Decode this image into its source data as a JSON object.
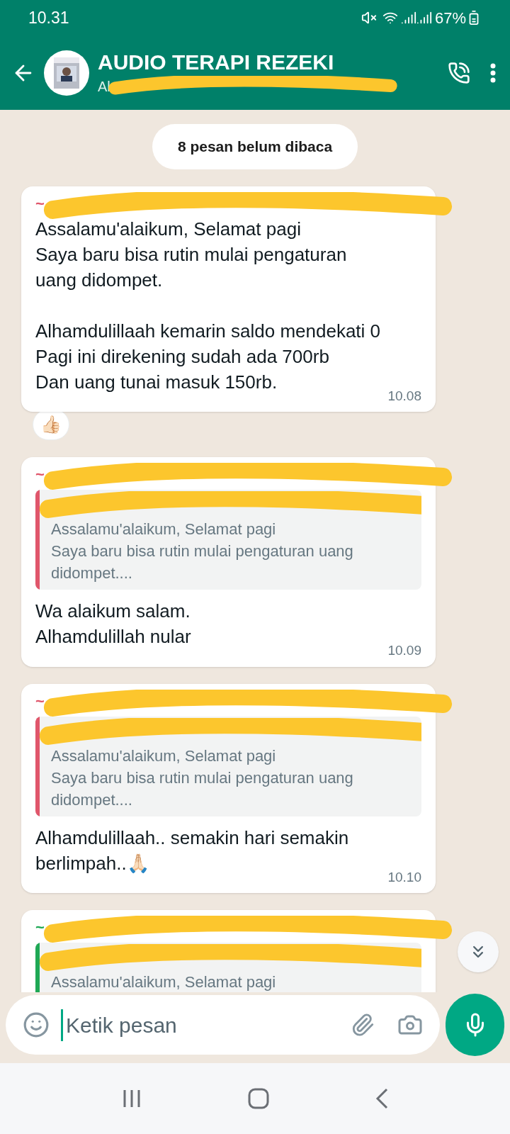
{
  "status_bar": {
    "time": "10.31",
    "battery": "67%"
  },
  "header": {
    "title": "AUDIO TERAPI REZEKI",
    "subtitle": "Al"
  },
  "unread_banner": "8 pesan belum dibaca",
  "messages": [
    {
      "sender": "~",
      "color": "#e0566b",
      "text": "Assalamu'alaikum, Selamat pagi\nSaya baru bisa rutin mulai pengaturan uang didompet.\n\nAlhamdulillaah kemarin saldo mendekati 0\nPagi ini direkening sudah ada 700rb\nDan uang tunai masuk 150rb.",
      "time": "10.08",
      "reaction": "👍🏻"
    },
    {
      "sender": "~",
      "color": "#e0566b",
      "quote": "Assalamu'alaikum, Selamat pagi\nSaya baru bisa rutin mulai pengaturan uang didompet....",
      "text": "Wa alaikum salam.\nAlhamdulillah nular",
      "time": "10.09"
    },
    {
      "sender": "~",
      "color": "#e0566b",
      "quote": "Assalamu'alaikum, Selamat pagi\nSaya baru bisa rutin mulai pengaturan uang didompet....",
      "text": "Alhamdulillaah.. semakin hari semakin berlimpah..🙏🏻",
      "time": "10.10"
    },
    {
      "sender": "~",
      "color": "#1fa855",
      "quote": "Assalamu'alaikum, Selamat pagi"
    }
  ],
  "composer": {
    "placeholder": "Ketik pesan"
  }
}
